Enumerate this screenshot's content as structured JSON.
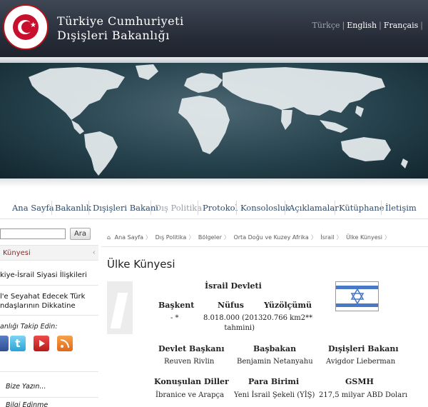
{
  "header": {
    "title_line1": "Türkiye Cumhuriyeti",
    "title_line2": "Dışişleri Bakanlığı",
    "lang_tr": "Türkçe",
    "lang_en": "English",
    "lang_fr": "Français",
    "lang_sep": "|",
    "colors": {
      "background": "#2a303b",
      "accent": "#c8102e"
    }
  },
  "nav": {
    "items": [
      "Ana Sayfa",
      "Bakanlık",
      "Dışişleri Bakanı",
      "Dış Politika",
      "Protokol",
      "Konsolosluk",
      "Açıklamalar",
      "Kütüphane",
      "İletişim"
    ],
    "active": "Dış Politika"
  },
  "sidebar": {
    "search_button": "Ara",
    "search_value": "",
    "section_title": "Künyesi",
    "link1": "kiye-İsrail Siyasi İlişkileri",
    "link2_line1": "l'e Seyahat Edecek Türk",
    "link2_line2": "ndaşlarının Dikkatine",
    "follow_label": "anlığı Takip Edin:",
    "social": [
      "facebook-icon",
      "twitter-icon",
      "youtube-icon",
      "rss-icon"
    ],
    "twitter_glyph": "t",
    "link3": "Bize Yazın...",
    "link4": "Bilgi Edinme"
  },
  "breadcrumb": {
    "items": [
      "Ana Sayfa",
      "Dış Politika",
      "Bölgeler",
      "Orta Doğu ve Kuzey Afrika",
      "İsrail",
      "Ülke Künyesi"
    ],
    "separator": "〉"
  },
  "main": {
    "page_title": "Ülke Künyesi",
    "country_name": "İsrail Devleti",
    "capital_label": "Başkent",
    "capital_value": "- *",
    "population_label": "Nüfus",
    "population_value_line1": "8.018.000 (2013",
    "population_value_line2": "tahmini)",
    "area_label": "Yüzölçümü",
    "area_value": "20.766 km2**",
    "head_of_state_label": "Devlet Başkanı",
    "head_of_state_value": "Reuven Rivlin",
    "prime_minister_label": "Başbakan",
    "prime_minister_value": "Benjamin Netanyahu",
    "fm_label": "Dışişleri Bakanı",
    "fm_value": "Avigdor Lieberman",
    "languages_label": "Konuşulan Diller",
    "languages_value": "İbranice ve Arapça",
    "currency_label": "Para Birimi",
    "currency_value": "Yeni İsrail Şekeli (YİŞ)",
    "gdp_label": "GSMH",
    "gdp_value": "217,5 milyar ABD Doları",
    "flag_colors": {
      "blue": "#4a78c8",
      "white": "#ffffff"
    }
  }
}
